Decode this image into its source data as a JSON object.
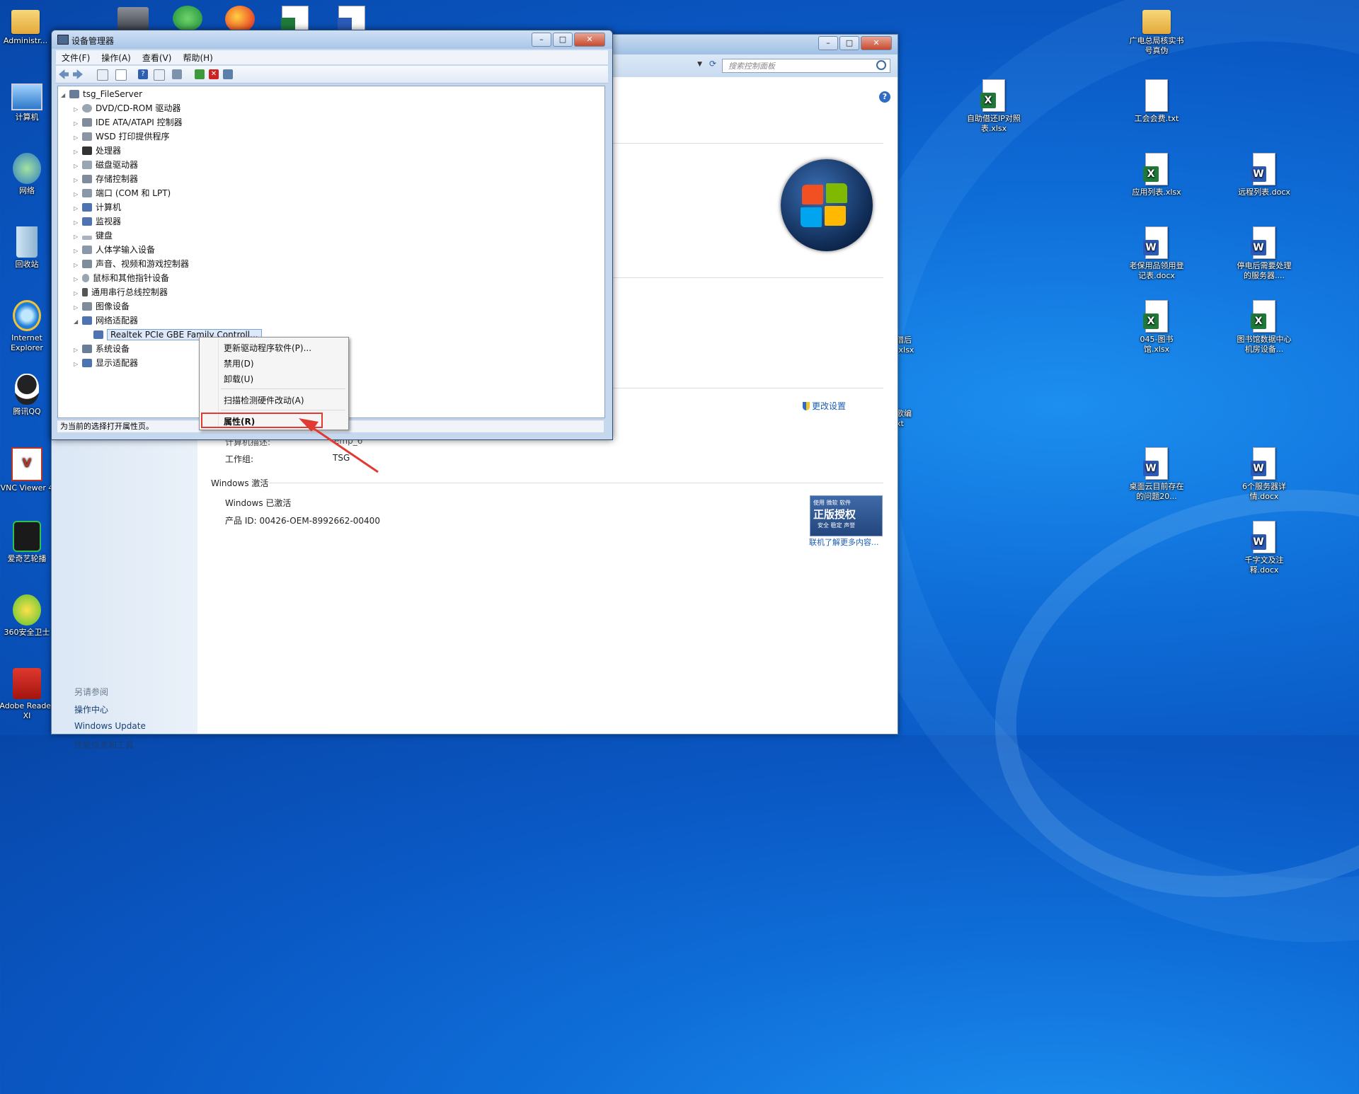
{
  "desktop": {
    "left_icons": [
      {
        "label": "Administr...",
        "icon": "folder-user-icon"
      },
      {
        "label": "计算机",
        "icon": "computer-icon"
      },
      {
        "label": "网络",
        "icon": "network-icon"
      },
      {
        "label": "回收站",
        "icon": "recycle-bin-icon"
      },
      {
        "label": "Internet Explorer",
        "icon": "internet-explorer-icon"
      },
      {
        "label": "腾讯QQ",
        "icon": "qq-icon"
      },
      {
        "label": "VNC Viewer 4",
        "icon": "vnc-icon"
      },
      {
        "label": "爱奇艺轮播",
        "icon": "iqiyi-icon"
      },
      {
        "label": "360安全卫士",
        "icon": "360-icon"
      },
      {
        "label": "Adobe Reader XI",
        "icon": "adobe-reader-icon"
      }
    ],
    "right_icons": [
      {
        "label": "广电总局核实书号真伪",
        "type": "folder"
      },
      {
        "label": "自助借还IP对照表.xlsx",
        "type": "excel"
      },
      {
        "label": "工会会费.txt",
        "type": "text"
      },
      {
        "label": "应用列表.xlsx",
        "type": "excel"
      },
      {
        "label": "远程列表.docx",
        "type": "word"
      },
      {
        "label": "老保用品领用登记表.docx",
        "type": "word"
      },
      {
        "label": "停电后需要处理的服务器....",
        "type": "word"
      },
      {
        "label": "045-图书馆.xlsx",
        "type": "excel"
      },
      {
        "label": "图书馆数据中心机房设备...",
        "type": "excel"
      },
      {
        "label": "桌面云目前存在的问题20...",
        "type": "word"
      },
      {
        "label": "6个服务器详情.docx",
        "type": "word"
      },
      {
        "label": "千字文及注释.docx",
        "type": "word"
      }
    ],
    "partial_labels": [
      "借后",
      ".xlsx",
      "歌编",
      "xt"
    ]
  },
  "control_panel": {
    "search_placeholder": "搜索控制面板",
    "change_settings": "更改设置",
    "computer_name_label": "计算机描述:",
    "computer_name_value": "emp_6",
    "workgroup_label": "工作组:",
    "workgroup_value": "TSG",
    "activation_header": "Windows 激活",
    "activation_status": "Windows 已激活",
    "product_id": "产品 ID: 00426-OEM-8992662-00400",
    "genuine_line1": "使用 微软 软件",
    "genuine_line2": "正版授权",
    "genuine_line3": "安全 稳定 声誉",
    "genuine_link": "联机了解更多内容...",
    "sidebar_header": "另请参阅",
    "sidebar_links": [
      "操作中心",
      "Windows Update",
      "性能信息和工具"
    ]
  },
  "device_manager": {
    "title": "设备管理器",
    "menus": [
      "文件(F)",
      "操作(A)",
      "查看(V)",
      "帮助(H)"
    ],
    "root": "tsg_FileServer",
    "nodes": [
      "DVD/CD-ROM 驱动器",
      "IDE ATA/ATAPI 控制器",
      "WSD 打印提供程序",
      "处理器",
      "磁盘驱动器",
      "存储控制器",
      "端口 (COM 和 LPT)",
      "计算机",
      "监视器",
      "键盘",
      "人体学输入设备",
      "声音、视频和游戏控制器",
      "鼠标和其他指针设备",
      "通用串行总线控制器",
      "图像设备",
      "网络适配器"
    ],
    "selected_child": "Realtek PCIe GBE Family Controll...",
    "after_nodes": [
      "系统设备",
      "显示适配器"
    ],
    "status": "为当前的选择打开属性页。"
  },
  "context_menu": {
    "items": [
      "更新驱动程序软件(P)...",
      "禁用(D)",
      "卸载(U)",
      "扫描检测硬件改动(A)",
      "属性(R)"
    ],
    "highlighted": "属性(R)",
    "highlight_color": "#e13a32"
  }
}
